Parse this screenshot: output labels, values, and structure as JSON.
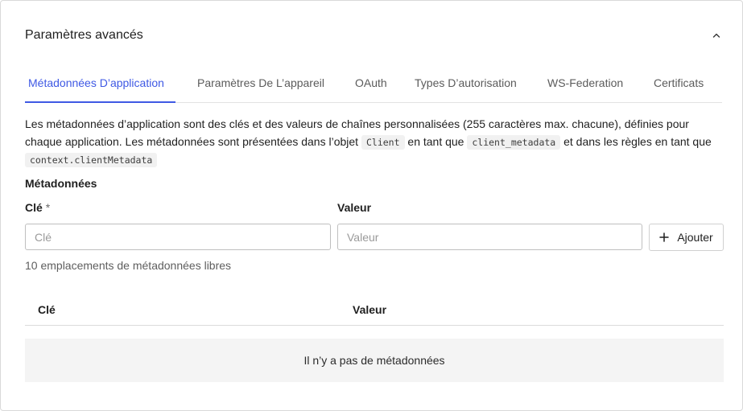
{
  "header": {
    "title": "Paramètres avancés",
    "collapse_icon": "chevron-up-icon"
  },
  "tabs": [
    {
      "label": "Métadonnées D’application",
      "active": true
    },
    {
      "label": "Paramètres De L’appareil",
      "active": false
    },
    {
      "label": "OAuth",
      "active": false
    },
    {
      "label": "Types D’autorisation",
      "active": false
    },
    {
      "label": "WS-Federation",
      "active": false
    },
    {
      "label": "Certificats",
      "active": false
    }
  ],
  "description": {
    "part1": "Les métadonnées d’application sont des clés et des valeurs de chaînes personnalisées (255 caractères max. chacune), définies pour chaque application. Les métadonnées sont présentées dans l’objet",
    "code1": "Client",
    "part2": "en tant que",
    "code2": "client_metadata",
    "part3": "et dans les règles en tant que",
    "code3": "context.clientMetadata"
  },
  "metadata_form": {
    "section_label": "Métadonnées",
    "key_label": "Clé",
    "required_mark": "*",
    "value_label": "Valeur",
    "key_input": {
      "value": "",
      "placeholder": "Clé"
    },
    "value_input": {
      "value": "",
      "placeholder": "Valeur"
    },
    "add_button_label": "Ajouter",
    "free_slots_text": "10 emplacements de métadonnées libres"
  },
  "table": {
    "columns": [
      "Clé",
      "Valeur"
    ],
    "rows": [],
    "empty_text": "Il n’y a pas de métadonnées"
  },
  "colors": {
    "accent": "#3f59e4",
    "border": "#d9d9d9",
    "empty_bg": "#f4f4f4"
  }
}
